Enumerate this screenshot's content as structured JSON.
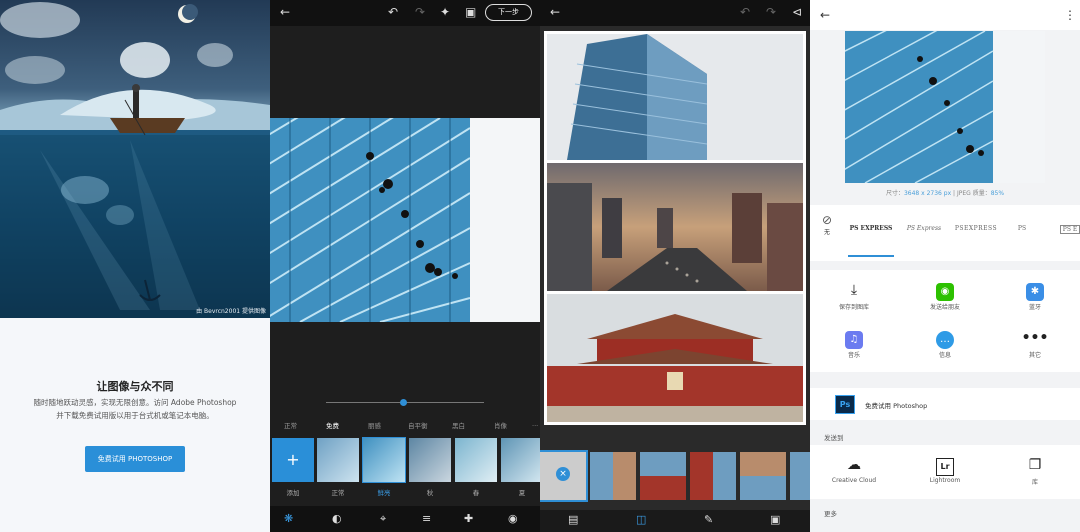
{
  "panel1": {
    "credit": "由 Bevrcn2001 提供图像",
    "title": "让图像与众不同",
    "desc_line1": "随时随地跃动灵感，实现无限创意。访问 Adobe Photoshop",
    "desc_line2": "并下载免费试用版以用于台式机或笔记本电脑。",
    "cta": "免费试用 PHOTOSHOP"
  },
  "panel2": {
    "next_label": "下一步",
    "filter_tabs": [
      "正常",
      "免费",
      "丽感",
      "自平衡",
      "黑白",
      "肖像",
      "..."
    ],
    "active_filter_tab": 1,
    "add_label": "添加",
    "thumb_labels": [
      "正常",
      "鲜亮",
      "秋",
      "春",
      "夏"
    ],
    "active_thumb": 1,
    "slider_value": 0.47,
    "icons": {
      "back": "back-arrow-icon",
      "undo": "undo-icon",
      "redo": "redo-icon",
      "magic": "magic-wand-icon",
      "compare": "compare-icon"
    },
    "bottom_icons": [
      "looks-icon",
      "adjust-icon",
      "crop-icon",
      "sliders-icon",
      "heal-icon",
      "eye-icon"
    ]
  },
  "panel3": {
    "icons": {
      "back": "back-arrow-icon",
      "undo": "undo-icon",
      "redo": "redo-icon",
      "share": "share-icon"
    },
    "bottom_icons": [
      "layout-icon",
      "grid-icon",
      "pen-icon",
      "frame-icon"
    ],
    "selected_thumb": 0
  },
  "panel4": {
    "size_label": "尺寸：",
    "size_value": "3648 x 2736 px",
    "size_sep": " | JPEG 质量：",
    "quality_value": "85%",
    "watermarks": [
      "无",
      "PS EXPRESS",
      "PS Express",
      "PSEXPRESS",
      "PS",
      "PS E"
    ],
    "share_items": [
      {
        "label": "保存到图库",
        "icon": "download-icon"
      },
      {
        "label": "发送给朋友",
        "icon": "wechat-icon"
      },
      {
        "label": "蓝牙",
        "icon": "bluetooth-icon"
      },
      {
        "label": "音乐",
        "icon": "music-icon"
      },
      {
        "label": "信息",
        "icon": "message-icon"
      },
      {
        "label": "其它",
        "icon": "more-icon"
      }
    ],
    "ps_label": "免费试用 Photoshop",
    "ps_icon_text": "Ps",
    "send_to": "发送到",
    "apps": [
      {
        "label": "Creative Cloud",
        "icon": "creative-cloud-icon"
      },
      {
        "label": "Lightroom",
        "icon": "lightroom-icon"
      },
      {
        "label": "库",
        "icon": "library-icon"
      }
    ],
    "lr_text": "Lr",
    "more_label": "更多"
  },
  "colors": {
    "accent": "#2a8fd8",
    "dark_bg": "#1e1e1e",
    "light_bg": "#f2f3f5"
  }
}
